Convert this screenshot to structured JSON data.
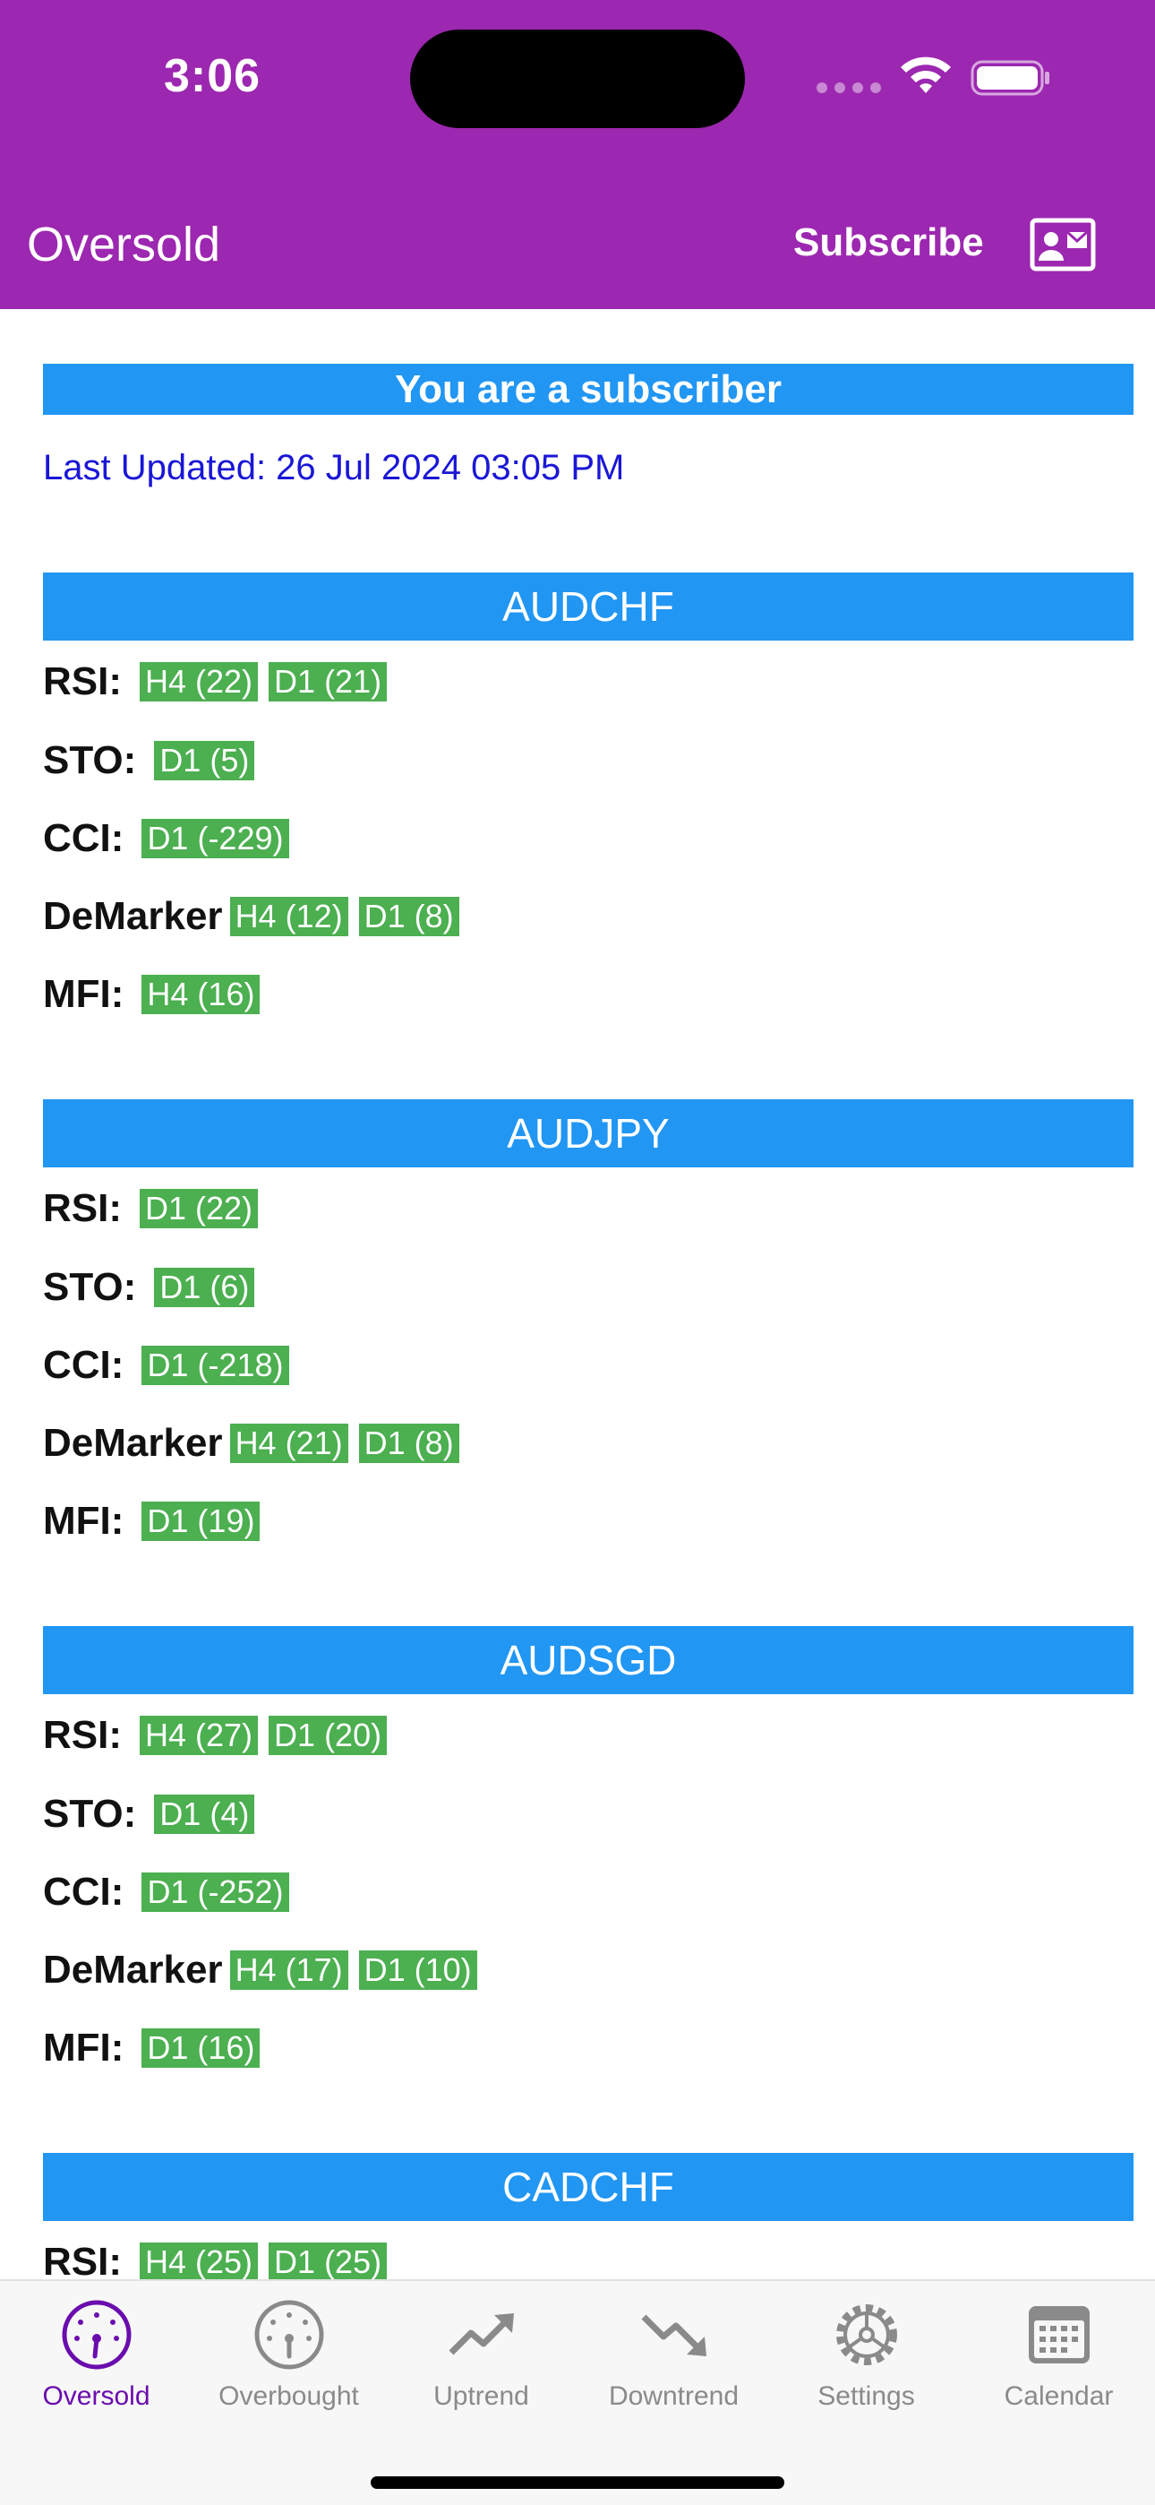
{
  "status_bar": {
    "time": "3:06"
  },
  "header": {
    "title": "Oversold",
    "subscribe_label": "Subscribe"
  },
  "banner": "You are a subscriber",
  "last_updated": "Last Updated: 26 Jul 2024 03:05 PM",
  "pairs": [
    {
      "name": "AUDCHF",
      "rows": [
        {
          "label": "RSI:",
          "tags": [
            "H4 (22)",
            "D1 (21)"
          ]
        },
        {
          "label": "STO:",
          "tags": [
            "D1 (5)"
          ]
        },
        {
          "label": "CCI:",
          "tags": [
            "D1 (-229)"
          ]
        },
        {
          "label": "DeMarker",
          "tags": [
            "H4 (12)",
            "D1 (8)"
          ]
        },
        {
          "label": "MFI:",
          "tags": [
            "H4 (16)"
          ]
        }
      ]
    },
    {
      "name": "AUDJPY",
      "rows": [
        {
          "label": "RSI:",
          "tags": [
            "D1 (22)"
          ]
        },
        {
          "label": "STO:",
          "tags": [
            "D1 (6)"
          ]
        },
        {
          "label": "CCI:",
          "tags": [
            "D1 (-218)"
          ]
        },
        {
          "label": "DeMarker",
          "tags": [
            "H4 (21)",
            "D1 (8)"
          ]
        },
        {
          "label": "MFI:",
          "tags": [
            "D1 (19)"
          ]
        }
      ]
    },
    {
      "name": "AUDSGD",
      "rows": [
        {
          "label": "RSI:",
          "tags": [
            "H4 (27)",
            "D1 (20)"
          ]
        },
        {
          "label": "STO:",
          "tags": [
            "D1 (4)"
          ]
        },
        {
          "label": "CCI:",
          "tags": [
            "D1 (-252)"
          ]
        },
        {
          "label": "DeMarker",
          "tags": [
            "H4 (17)",
            "D1 (10)"
          ]
        },
        {
          "label": "MFI:",
          "tags": [
            "D1 (16)"
          ]
        }
      ]
    },
    {
      "name": "CADCHF",
      "rows": [
        {
          "label": "RSI:",
          "tags": [
            "H4 (25)",
            "D1 (25)"
          ]
        }
      ]
    }
  ],
  "tabs": [
    {
      "label": "Oversold",
      "icon": "gauge-low-icon",
      "active": true
    },
    {
      "label": "Overbought",
      "icon": "gauge-icon",
      "active": false
    },
    {
      "label": "Uptrend",
      "icon": "trending-up-icon",
      "active": false
    },
    {
      "label": "Downtrend",
      "icon": "trending-down-icon",
      "active": false
    },
    {
      "label": "Settings",
      "icon": "gear-icon",
      "active": false
    },
    {
      "label": "Calendar",
      "icon": "calendar-icon",
      "active": false
    }
  ],
  "colors": {
    "header_bg": "#9c27b0",
    "pair_header_bg": "#2196f3",
    "tag_bg": "#4caf50",
    "last_updated_text": "#1a16d6",
    "active_tab": "#6a0dad",
    "inactive_tab": "#8a8a8a"
  }
}
